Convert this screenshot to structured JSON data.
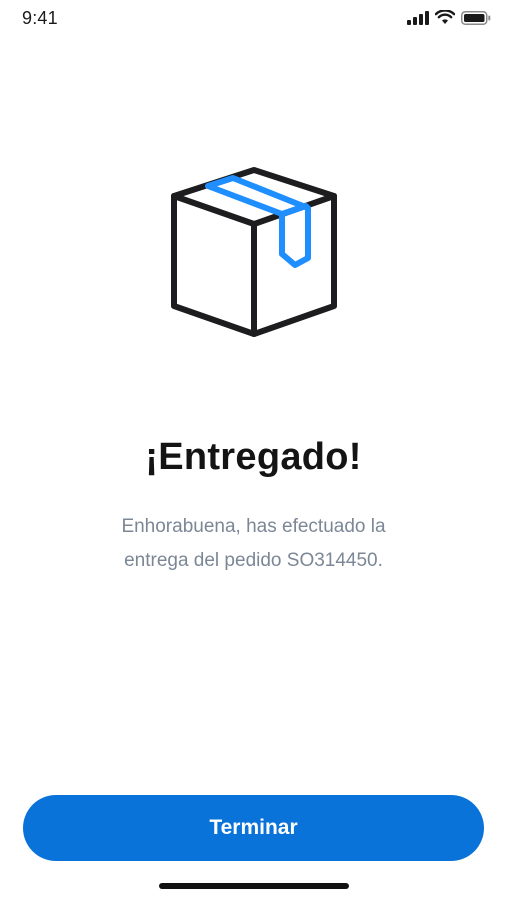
{
  "status_bar": {
    "time": "9:41",
    "icons": [
      "signal-icon",
      "wifi-icon",
      "battery-icon"
    ]
  },
  "illustration": {
    "icon": "package-box-icon",
    "colors": {
      "outline": "#1d1d1f",
      "tape": "#1f8fff"
    }
  },
  "main": {
    "title": "¡Entregado!",
    "message_line1": "Enhorabuena, has efectuado la",
    "message_line2": "entrega del pedido SO314450."
  },
  "footer": {
    "primary_button_label": "Terminar",
    "accent_color": "#0a73d9"
  }
}
